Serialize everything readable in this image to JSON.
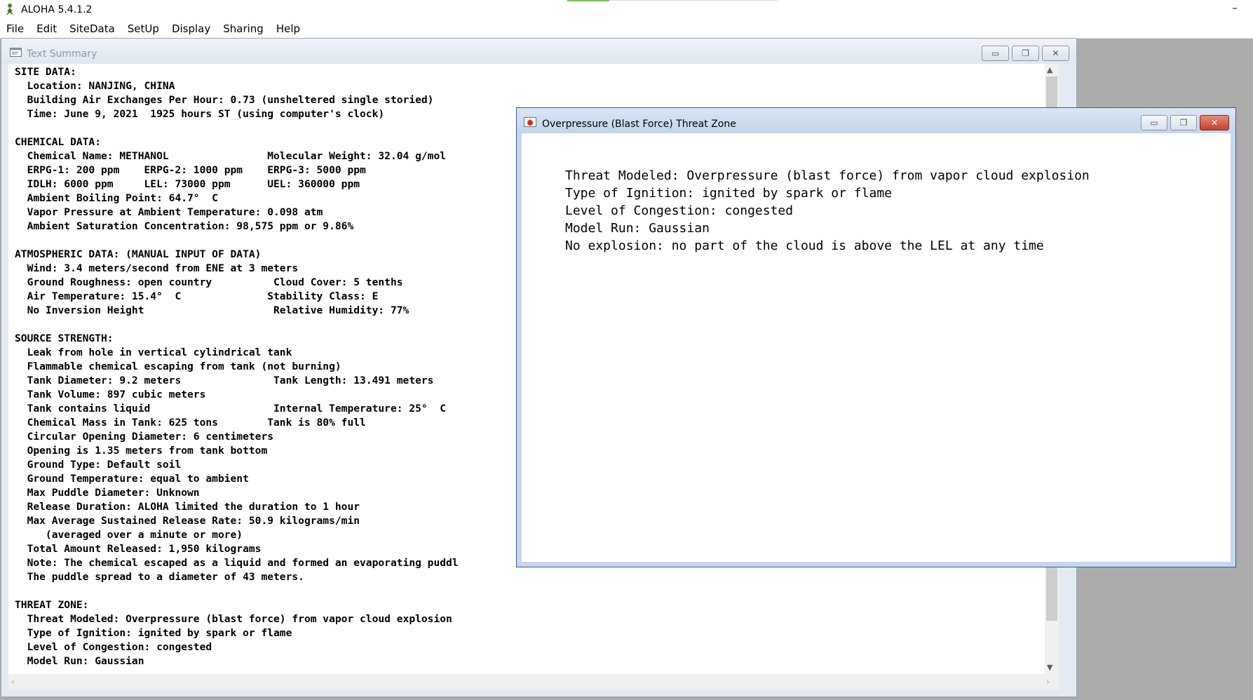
{
  "app": {
    "title": "ALOHA 5.4.1.2",
    "minimize": "–"
  },
  "menu": [
    "File",
    "Edit",
    "SiteData",
    "SetUp",
    "Display",
    "Sharing",
    "Help"
  ],
  "text_summary": {
    "title": "Text Summary",
    "buttons": {
      "minimize": "▭",
      "restore": "❐",
      "close": "✕"
    },
    "lines": [
      "SITE DATA:",
      "  Location: NANJING, CHINA",
      "  Building Air Exchanges Per Hour: 0.73 (unsheltered single storied)",
      "  Time: June 9, 2021  1925 hours ST (using computer's clock)",
      "",
      "CHEMICAL DATA:",
      "  Chemical Name: METHANOL                Molecular Weight: 32.04 g/mol",
      "  ERPG-1: 200 ppm    ERPG-2: 1000 ppm    ERPG-3: 5000 ppm",
      "  IDLH: 6000 ppm     LEL: 73000 ppm      UEL: 360000 ppm",
      "  Ambient Boiling Point: 64.7°  C",
      "  Vapor Pressure at Ambient Temperature: 0.098 atm",
      "  Ambient Saturation Concentration: 98,575 ppm or 9.86%",
      "",
      "ATMOSPHERIC DATA: (MANUAL INPUT OF DATA)",
      "  Wind: 3.4 meters/second from ENE at 3 meters",
      "  Ground Roughness: open country          Cloud Cover: 5 tenths",
      "  Air Temperature: 15.4°  C              Stability Class: E",
      "  No Inversion Height                     Relative Humidity: 77%",
      "",
      "SOURCE STRENGTH:",
      "  Leak from hole in vertical cylindrical tank",
      "  Flammable chemical escaping from tank (not burning)",
      "  Tank Diameter: 9.2 meters               Tank Length: 13.491 meters",
      "  Tank Volume: 897 cubic meters",
      "  Tank contains liquid                    Internal Temperature: 25°  C",
      "  Chemical Mass in Tank: 625 tons        Tank is 80% full",
      "  Circular Opening Diameter: 6 centimeters",
      "  Opening is 1.35 meters from tank bottom",
      "  Ground Type: Default soil",
      "  Ground Temperature: equal to ambient",
      "  Max Puddle Diameter: Unknown",
      "  Release Duration: ALOHA limited the duration to 1 hour",
      "  Max Average Sustained Release Rate: 50.9 kilograms/min",
      "     (averaged over a minute or more)",
      "  Total Amount Released: 1,950 kilograms",
      "  Note: The chemical escaped as a liquid and formed an evaporating puddl",
      "  The puddle spread to a diameter of 43 meters.",
      "",
      "THREAT ZONE:",
      "  Threat Modeled: Overpressure (blast force) from vapor cloud explosion",
      "  Type of Ignition: ignited by spark or flame",
      "  Level of Congestion: congested",
      "  Model Run: Gaussian"
    ]
  },
  "threat_zone": {
    "title": "Overpressure (Blast Force) Threat Zone",
    "buttons": {
      "minimize": "▭",
      "restore": "❐",
      "close": "✕"
    },
    "lines": [
      "Threat Modeled: Overpressure (blast force) from vapor cloud explosion",
      "Type of Ignition: ignited by spark or flame",
      "Level of Congestion: congested",
      "Model Run: Gaussian",
      "No explosion: no part of the cloud is above the LEL at any time"
    ]
  }
}
